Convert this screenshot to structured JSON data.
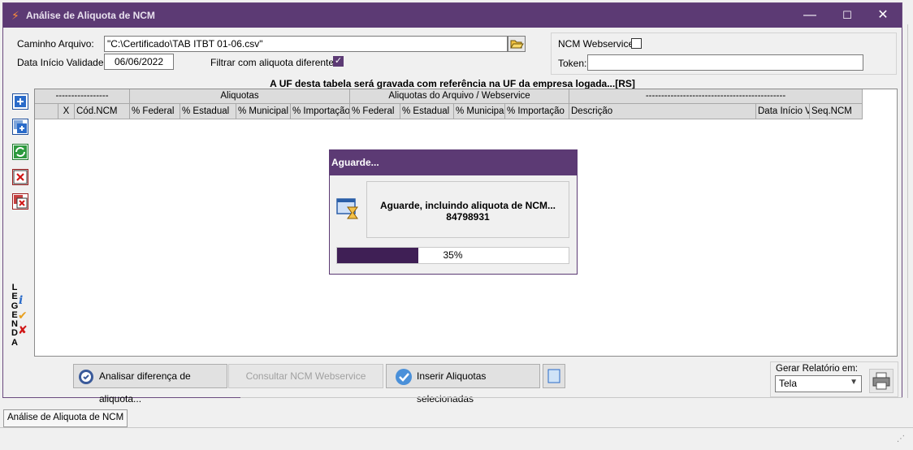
{
  "window": {
    "title": "Análise de Aliquota de NCM",
    "minimize": "—",
    "maximize": "☐",
    "close": "✕"
  },
  "form": {
    "file_path_label": "Caminho Arquivo:",
    "file_path_value": "\"C:\\Certificado\\TAB ITBT 01-06.csv\"",
    "validity_label": "Data Início Validade:",
    "validity_value": "06/06/2022",
    "filter_label": "Filtrar com aliquota diferente:",
    "filter_checked": true,
    "ncm_ws_label": "NCM Webservice:",
    "ncm_ws_checked": false,
    "token_label": "Token:",
    "token_value": ""
  },
  "banner": "A UF desta tabela será gravada com referência na UF da empresa logada...[RS]",
  "grid": {
    "group_headers": [
      "-----------------",
      "Aliquotas",
      "Aliquotas do Arquivo / Webservice",
      "---------------------------------------------"
    ],
    "columns": [
      "X",
      "Cód.NCM",
      "% Federal",
      "% Estadual",
      "% Municipal",
      "% Importação",
      "% Federal",
      "% Estadual",
      "% Municipal",
      "% Importação",
      "Descrição",
      "Data Início Va",
      "Seq.NCM"
    ]
  },
  "legend": {
    "letters": [
      "L",
      "E",
      "G",
      "E",
      "N",
      "D",
      "A"
    ],
    "icons": [
      "info-icon",
      "check-icon",
      "cross-icon"
    ]
  },
  "dialog": {
    "title": "Aguarde...",
    "message": "Aguarde, incluindo aliquota de NCM...",
    "ncm_code": "84798931",
    "progress_percent": 35,
    "progress_label": "35%"
  },
  "buttons": {
    "analisar": "Analisar diferença de aliquota...",
    "consultar": "Consultar NCM Webservice",
    "inserir": "Inserir Aliquotas selecionadas"
  },
  "report": {
    "label": "Gerar Relatório em:",
    "selected": "Tela"
  },
  "tabs": [
    "Análise de Aliquota de NCM"
  ],
  "colors": {
    "titlebar": "#5c3a74",
    "progress_fill": "#3f1f55"
  }
}
